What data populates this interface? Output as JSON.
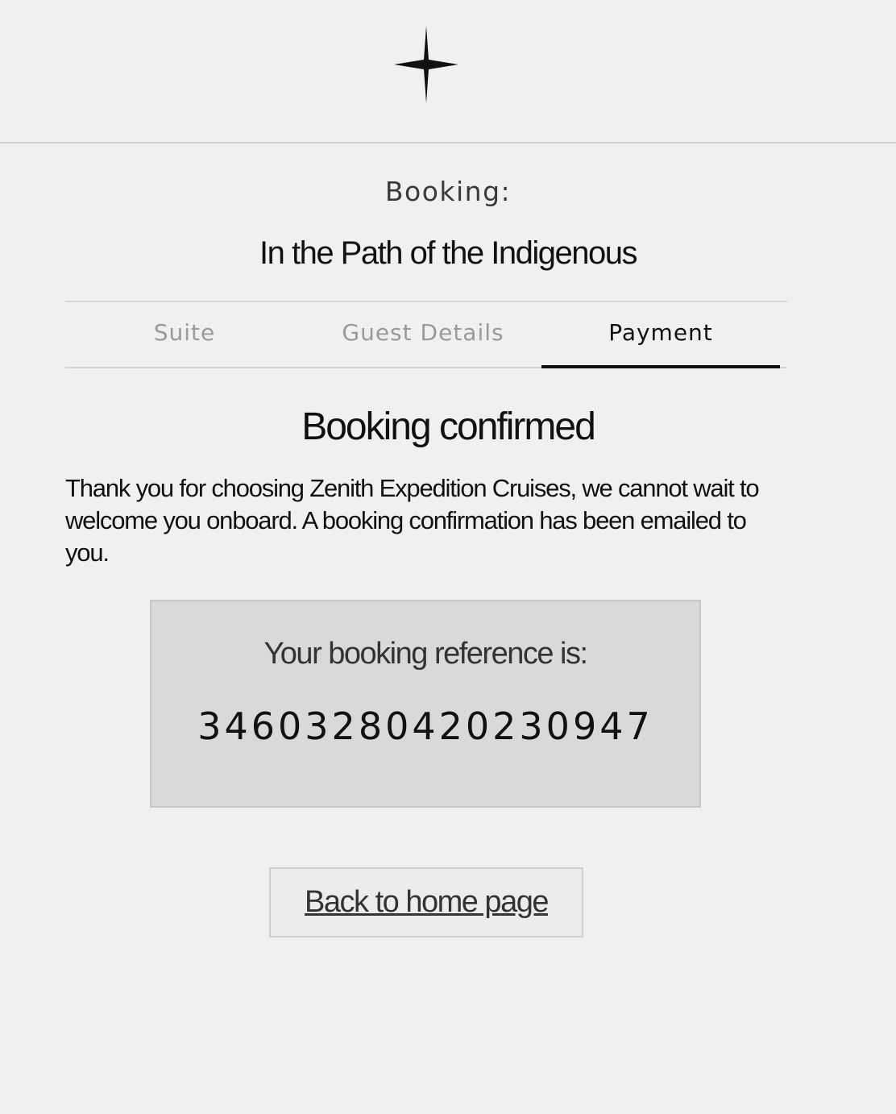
{
  "header": {
    "logo_icon": "four-point-star-icon"
  },
  "booking": {
    "label": "Booking:",
    "trip_title": "In the Path of the Indigenous"
  },
  "tabs": [
    {
      "label": "Suite",
      "active": false
    },
    {
      "label": "Guest Details",
      "active": false
    },
    {
      "label": "Payment",
      "active": true
    }
  ],
  "confirmation": {
    "heading": "Booking confirmed",
    "message": "Thank you for choosing Zenith Expedition Cruises, we cannot wait to welcome you onboard. A booking confirmation has been emailed to you.",
    "reference_label": "Your booking reference is:",
    "reference_number": "34603280420230947"
  },
  "actions": {
    "home_button_label": "Back to home page"
  },
  "colors": {
    "background": "#f0f0f0",
    "reference_box": "#d9d9d9",
    "active_tab_underline": "#111111",
    "inactive_tab_text": "#9a9a9a"
  }
}
